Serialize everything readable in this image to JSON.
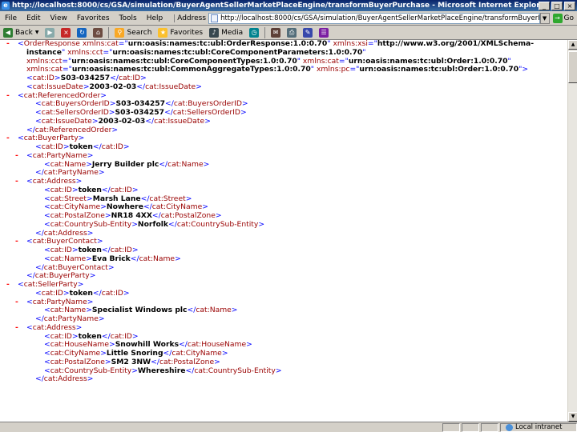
{
  "window": {
    "title": "http://localhost:8000/cs/GSA/simulation/BuyerAgentSellerMarketPlaceEngine/transformBuyerPurchase - Microsoft Internet Explorer p"
  },
  "menu": {
    "items": [
      "File",
      "Edit",
      "View",
      "Favorites",
      "Tools",
      "Help"
    ],
    "address_label": "Address",
    "address_value": "http://localhost:8000/cs/GSA/simulation/BuyerAgentSellerMarketPlaceEngine/transformBuyerPurchase.jsp?documentNa",
    "go_label": "Go"
  },
  "toolbar": {
    "back": "Back",
    "search": "Search",
    "favorites": "Favorites",
    "media": "Media"
  },
  "status": {
    "text": "",
    "zone": "Local intranet"
  },
  "xml_lines": [
    {
      "indent": 0,
      "toggle": "-",
      "segs": [
        [
          "m",
          "<"
        ],
        [
          "t",
          "OrderResponse"
        ],
        [
          "at",
          " xmlns:cat"
        ],
        [
          "m",
          "=\""
        ],
        [
          "av",
          "urn:oasis:names:tc:ubl:OrderResponse:1.0:0.70"
        ],
        [
          "m",
          "\""
        ],
        [
          "at",
          " xmlns:xsi"
        ],
        [
          "m",
          "=\""
        ],
        [
          "av",
          "http://www.w3.org/2001/XMLSchema-"
        ]
      ]
    },
    {
      "indent": 1,
      "toggle": "",
      "segs": [
        [
          "av",
          "instance"
        ],
        [
          "m",
          "\""
        ],
        [
          "at",
          " xmlns:cct"
        ],
        [
          "m",
          "=\""
        ],
        [
          "av",
          "urn:oasis:names:tc:ubl:CoreComponentParameters:1.0:0.70"
        ],
        [
          "m",
          "\""
        ]
      ]
    },
    {
      "indent": 1,
      "toggle": "",
      "segs": [
        [
          "at",
          "xmlns:cct"
        ],
        [
          "m",
          "=\""
        ],
        [
          "av",
          "urn:oasis:names:tc:ubl:CoreComponentTypes:1.0:0.70"
        ],
        [
          "m",
          "\""
        ],
        [
          "at",
          " xmlns:cat"
        ],
        [
          "m",
          "=\""
        ],
        [
          "av",
          "urn:oasis:names:tc:ubl:Order:1.0:0.70"
        ],
        [
          "m",
          "\""
        ]
      ]
    },
    {
      "indent": 1,
      "toggle": "",
      "segs": [
        [
          "at",
          "xmlns:cat"
        ],
        [
          "m",
          "=\""
        ],
        [
          "av",
          "urn:oasis:names:tc:ubl:CommonAggregateTypes:1.0:0.70"
        ],
        [
          "m",
          "\""
        ],
        [
          "at",
          " xmlns:pc"
        ],
        [
          "m",
          "=\""
        ],
        [
          "av",
          "urn:oasis:names:tc:ubl:Order:1.0:0.70"
        ],
        [
          "m",
          "\">"
        ]
      ]
    },
    {
      "indent": 1,
      "toggle": "",
      "segs": [
        [
          "m",
          "<"
        ],
        [
          "t",
          "cat:ID"
        ],
        [
          "m",
          ">"
        ],
        [
          "x",
          "S03-034257"
        ],
        [
          "m",
          "</"
        ],
        [
          "t",
          "cat:ID"
        ],
        [
          "m",
          ">"
        ]
      ]
    },
    {
      "indent": 1,
      "toggle": "",
      "segs": [
        [
          "m",
          "<"
        ],
        [
          "t",
          "cat:IssueDate"
        ],
        [
          "m",
          ">"
        ],
        [
          "x",
          "2003-02-03"
        ],
        [
          "m",
          "</"
        ],
        [
          "t",
          "cat:IssueDate"
        ],
        [
          "m",
          ">"
        ]
      ]
    },
    {
      "indent": 0,
      "toggle": "-",
      "segs": [
        [
          "m",
          "<"
        ],
        [
          "t",
          "cat:ReferencedOrder"
        ],
        [
          "m",
          ">"
        ]
      ]
    },
    {
      "indent": 2,
      "toggle": "",
      "segs": [
        [
          "m",
          "<"
        ],
        [
          "t",
          "cat:BuyersOrderID"
        ],
        [
          "m",
          ">"
        ],
        [
          "x",
          "S03-034257"
        ],
        [
          "m",
          "</"
        ],
        [
          "t",
          "cat:BuyersOrderID"
        ],
        [
          "m",
          ">"
        ]
      ]
    },
    {
      "indent": 2,
      "toggle": "",
      "segs": [
        [
          "m",
          "<"
        ],
        [
          "t",
          "cat:SellersOrderID"
        ],
        [
          "m",
          ">"
        ],
        [
          "x",
          "S03-034257"
        ],
        [
          "m",
          "</"
        ],
        [
          "t",
          "cat:SellersOrderID"
        ],
        [
          "m",
          ">"
        ]
      ]
    },
    {
      "indent": 2,
      "toggle": "",
      "segs": [
        [
          "m",
          "<"
        ],
        [
          "t",
          "cat:IssueDate"
        ],
        [
          "m",
          ">"
        ],
        [
          "x",
          "2003-02-03"
        ],
        [
          "m",
          "</"
        ],
        [
          "t",
          "cat:IssueDate"
        ],
        [
          "m",
          ">"
        ]
      ]
    },
    {
      "indent": 1,
      "toggle": "",
      "segs": [
        [
          "m",
          "</"
        ],
        [
          "t",
          "cat:ReferencedOrder"
        ],
        [
          "m",
          ">"
        ]
      ]
    },
    {
      "indent": 0,
      "toggle": "-",
      "segs": [
        [
          "m",
          "<"
        ],
        [
          "t",
          "cat:BuyerParty"
        ],
        [
          "m",
          ">"
        ]
      ]
    },
    {
      "indent": 2,
      "toggle": "",
      "segs": [
        [
          "m",
          "<"
        ],
        [
          "t",
          "cat:ID"
        ],
        [
          "m",
          ">"
        ],
        [
          "x",
          "token"
        ],
        [
          "m",
          "</"
        ],
        [
          "t",
          "cat:ID"
        ],
        [
          "m",
          ">"
        ]
      ]
    },
    {
      "indent": 1,
      "toggle": "-",
      "segs": [
        [
          "m",
          "<"
        ],
        [
          "t",
          "cat:PartyName"
        ],
        [
          "m",
          ">"
        ]
      ]
    },
    {
      "indent": 3,
      "toggle": "",
      "segs": [
        [
          "m",
          "<"
        ],
        [
          "t",
          "cat:Name"
        ],
        [
          "m",
          ">"
        ],
        [
          "x",
          "Jerry Builder plc"
        ],
        [
          "m",
          "</"
        ],
        [
          "t",
          "cat:Name"
        ],
        [
          "m",
          ">"
        ]
      ]
    },
    {
      "indent": 2,
      "toggle": "",
      "segs": [
        [
          "m",
          "</"
        ],
        [
          "t",
          "cat:PartyName"
        ],
        [
          "m",
          ">"
        ]
      ]
    },
    {
      "indent": 1,
      "toggle": "-",
      "segs": [
        [
          "m",
          "<"
        ],
        [
          "t",
          "cat:Address"
        ],
        [
          "m",
          ">"
        ]
      ]
    },
    {
      "indent": 3,
      "toggle": "",
      "segs": [
        [
          "m",
          "<"
        ],
        [
          "t",
          "cat:ID"
        ],
        [
          "m",
          ">"
        ],
        [
          "x",
          "token"
        ],
        [
          "m",
          "</"
        ],
        [
          "t",
          "cat:ID"
        ],
        [
          "m",
          ">"
        ]
      ]
    },
    {
      "indent": 3,
      "toggle": "",
      "segs": [
        [
          "m",
          "<"
        ],
        [
          "t",
          "cat:Street"
        ],
        [
          "m",
          ">"
        ],
        [
          "x",
          "Marsh Lane"
        ],
        [
          "m",
          "</"
        ],
        [
          "t",
          "cat:Street"
        ],
        [
          "m",
          ">"
        ]
      ]
    },
    {
      "indent": 3,
      "toggle": "",
      "segs": [
        [
          "m",
          "<"
        ],
        [
          "t",
          "cat:CityName"
        ],
        [
          "m",
          ">"
        ],
        [
          "x",
          "Nowhere"
        ],
        [
          "m",
          "</"
        ],
        [
          "t",
          "cat:CityName"
        ],
        [
          "m",
          ">"
        ]
      ]
    },
    {
      "indent": 3,
      "toggle": "",
      "segs": [
        [
          "m",
          "<"
        ],
        [
          "t",
          "cat:PostalZone"
        ],
        [
          "m",
          ">"
        ],
        [
          "x",
          "NR18 4XX"
        ],
        [
          "m",
          "</"
        ],
        [
          "t",
          "cat:PostalZone"
        ],
        [
          "m",
          ">"
        ]
      ]
    },
    {
      "indent": 3,
      "toggle": "",
      "segs": [
        [
          "m",
          "<"
        ],
        [
          "t",
          "cat:CountrySub-Entity"
        ],
        [
          "m",
          ">"
        ],
        [
          "x",
          "Norfolk"
        ],
        [
          "m",
          "</"
        ],
        [
          "t",
          "cat:CountrySub-Entity"
        ],
        [
          "m",
          ">"
        ]
      ]
    },
    {
      "indent": 2,
      "toggle": "",
      "segs": [
        [
          "m",
          "</"
        ],
        [
          "t",
          "cat:Address"
        ],
        [
          "m",
          ">"
        ]
      ]
    },
    {
      "indent": 1,
      "toggle": "-",
      "segs": [
        [
          "m",
          "<"
        ],
        [
          "t",
          "cat:BuyerContact"
        ],
        [
          "m",
          ">"
        ]
      ]
    },
    {
      "indent": 3,
      "toggle": "",
      "segs": [
        [
          "m",
          "<"
        ],
        [
          "t",
          "cat:ID"
        ],
        [
          "m",
          ">"
        ],
        [
          "x",
          "token"
        ],
        [
          "m",
          "</"
        ],
        [
          "t",
          "cat:ID"
        ],
        [
          "m",
          ">"
        ]
      ]
    },
    {
      "indent": 3,
      "toggle": "",
      "segs": [
        [
          "m",
          "<"
        ],
        [
          "t",
          "cat:Name"
        ],
        [
          "m",
          ">"
        ],
        [
          "x",
          "Eva Brick"
        ],
        [
          "m",
          "</"
        ],
        [
          "t",
          "cat:Name"
        ],
        [
          "m",
          ">"
        ]
      ]
    },
    {
      "indent": 2,
      "toggle": "",
      "segs": [
        [
          "m",
          "</"
        ],
        [
          "t",
          "cat:BuyerContact"
        ],
        [
          "m",
          ">"
        ]
      ]
    },
    {
      "indent": 1,
      "toggle": "",
      "segs": [
        [
          "m",
          "</"
        ],
        [
          "t",
          "cat:BuyerParty"
        ],
        [
          "m",
          ">"
        ]
      ]
    },
    {
      "indent": 0,
      "toggle": "-",
      "segs": [
        [
          "m",
          "<"
        ],
        [
          "t",
          "cat:SellerParty"
        ],
        [
          "m",
          ">"
        ]
      ]
    },
    {
      "indent": 2,
      "toggle": "",
      "segs": [
        [
          "m",
          "<"
        ],
        [
          "t",
          "cat:ID"
        ],
        [
          "m",
          ">"
        ],
        [
          "x",
          "token"
        ],
        [
          "m",
          "</"
        ],
        [
          "t",
          "cat:ID"
        ],
        [
          "m",
          ">"
        ]
      ]
    },
    {
      "indent": 1,
      "toggle": "-",
      "segs": [
        [
          "m",
          "<"
        ],
        [
          "t",
          "cat:PartyName"
        ],
        [
          "m",
          ">"
        ]
      ]
    },
    {
      "indent": 3,
      "toggle": "",
      "segs": [
        [
          "m",
          "<"
        ],
        [
          "t",
          "cat:Name"
        ],
        [
          "m",
          ">"
        ],
        [
          "x",
          "Specialist Windows plc"
        ],
        [
          "m",
          "</"
        ],
        [
          "t",
          "cat:Name"
        ],
        [
          "m",
          ">"
        ]
      ]
    },
    {
      "indent": 2,
      "toggle": "",
      "segs": [
        [
          "m",
          "</"
        ],
        [
          "t",
          "cat:PartyName"
        ],
        [
          "m",
          ">"
        ]
      ]
    },
    {
      "indent": 1,
      "toggle": "-",
      "segs": [
        [
          "m",
          "<"
        ],
        [
          "t",
          "cat:Address"
        ],
        [
          "m",
          ">"
        ]
      ]
    },
    {
      "indent": 3,
      "toggle": "",
      "segs": [
        [
          "m",
          "<"
        ],
        [
          "t",
          "cat:ID"
        ],
        [
          "m",
          ">"
        ],
        [
          "x",
          "token"
        ],
        [
          "m",
          "</"
        ],
        [
          "t",
          "cat:ID"
        ],
        [
          "m",
          ">"
        ]
      ]
    },
    {
      "indent": 3,
      "toggle": "",
      "segs": [
        [
          "m",
          "<"
        ],
        [
          "t",
          "cat:HouseName"
        ],
        [
          "m",
          ">"
        ],
        [
          "x",
          "Snowhill Works"
        ],
        [
          "m",
          "</"
        ],
        [
          "t",
          "cat:HouseName"
        ],
        [
          "m",
          ">"
        ]
      ]
    },
    {
      "indent": 3,
      "toggle": "",
      "segs": [
        [
          "m",
          "<"
        ],
        [
          "t",
          "cat:CityName"
        ],
        [
          "m",
          ">"
        ],
        [
          "x",
          "Little Snoring"
        ],
        [
          "m",
          "</"
        ],
        [
          "t",
          "cat:CityName"
        ],
        [
          "m",
          ">"
        ]
      ]
    },
    {
      "indent": 3,
      "toggle": "",
      "segs": [
        [
          "m",
          "<"
        ],
        [
          "t",
          "cat:PostalZone"
        ],
        [
          "m",
          ">"
        ],
        [
          "x",
          "SM2 3NW"
        ],
        [
          "m",
          "</"
        ],
        [
          "t",
          "cat:PostalZone"
        ],
        [
          "m",
          ">"
        ]
      ]
    },
    {
      "indent": 3,
      "toggle": "",
      "segs": [
        [
          "m",
          "<"
        ],
        [
          "t",
          "cat:CountrySub-Entity"
        ],
        [
          "m",
          ">"
        ],
        [
          "x",
          "Whereshire"
        ],
        [
          "m",
          "</"
        ],
        [
          "t",
          "cat:CountrySub-Entity"
        ],
        [
          "m",
          ">"
        ]
      ]
    },
    {
      "indent": 2,
      "toggle": "",
      "segs": [
        [
          "m",
          "</"
        ],
        [
          "t",
          "cat:Address"
        ],
        [
          "m",
          ">"
        ]
      ]
    }
  ]
}
